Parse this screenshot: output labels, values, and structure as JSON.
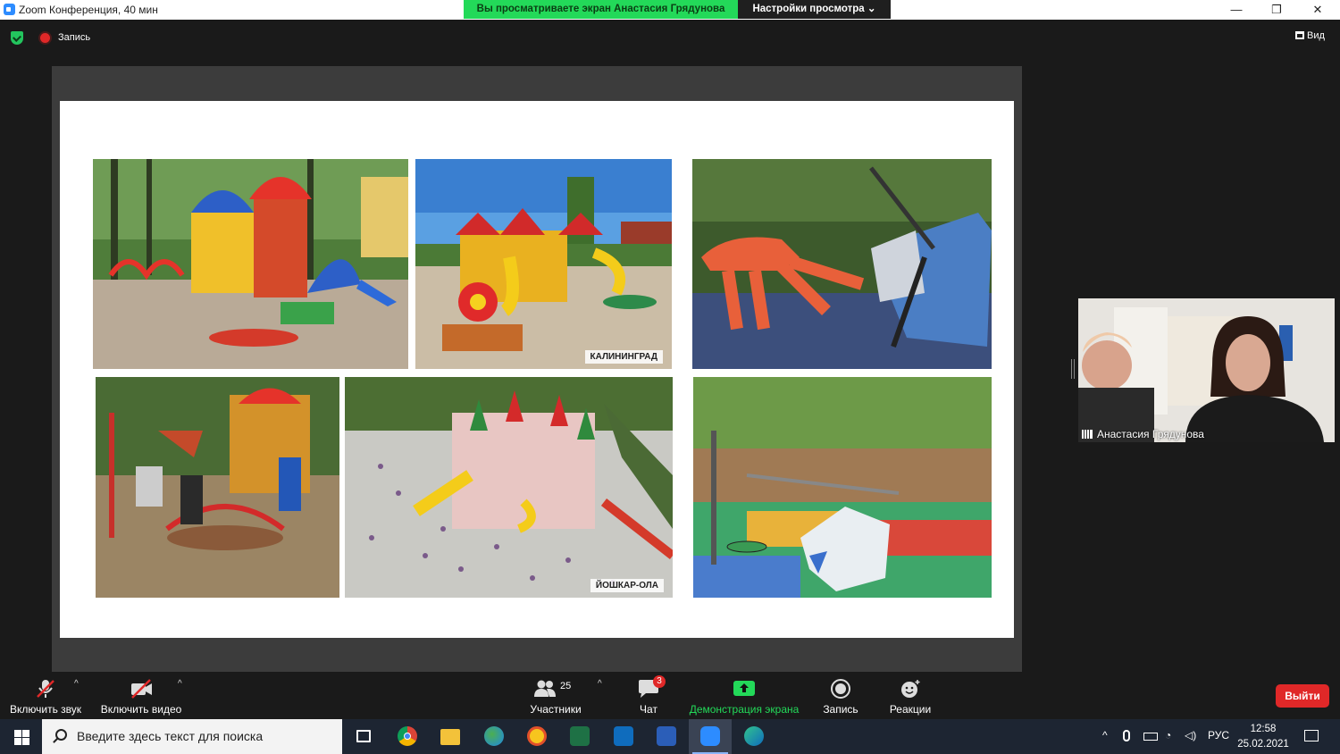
{
  "window": {
    "title": "Zoom Конференция, 40 мин",
    "controls": [
      "minimize",
      "restore",
      "close"
    ]
  },
  "share_banner": {
    "text": "Вы просматриваете экран Анастасия Грядунова",
    "view_settings": "Настройки просмотра"
  },
  "meeting_bar": {
    "recording_label": "Запись",
    "view_label": "Вид"
  },
  "slide": {
    "photos": [
      {
        "name": "photo-playground-park",
        "label": ""
      },
      {
        "name": "photo-playground-kaliningrad",
        "label": "КАЛИНИНГРАД"
      },
      {
        "name": "photo-playground-octopus-ship",
        "label": ""
      },
      {
        "name": "photo-carousel-children",
        "label": ""
      },
      {
        "name": "photo-playground-yoshkar-ola",
        "label": "ЙОШКАР-ОЛА"
      },
      {
        "name": "photo-playground-modern",
        "label": ""
      }
    ]
  },
  "video": {
    "participant_name": "Анастасия Грядунова"
  },
  "toolbar": {
    "unmute": "Включить звук",
    "start_video": "Включить видео",
    "participants": "Участники",
    "participants_count": "25",
    "chat": "Чат",
    "chat_badge": "3",
    "share_screen": "Демонстрация экрана",
    "record": "Запись",
    "reactions": "Реакции",
    "leave": "Выйти"
  },
  "taskbar": {
    "search_placeholder": "Введите здесь текст для поиска",
    "apps": [
      "task-view",
      "chrome",
      "file-explorer",
      "maps",
      "1c",
      "excel",
      "outlook",
      "word",
      "zoom",
      "edge"
    ],
    "language": "РУС",
    "time": "12:58",
    "date": "25.02.2021"
  },
  "colors": {
    "banner_green": "#23d959",
    "leave_red": "#e02828",
    "share_green": "#23d959",
    "taskbar": "#1d2532"
  }
}
